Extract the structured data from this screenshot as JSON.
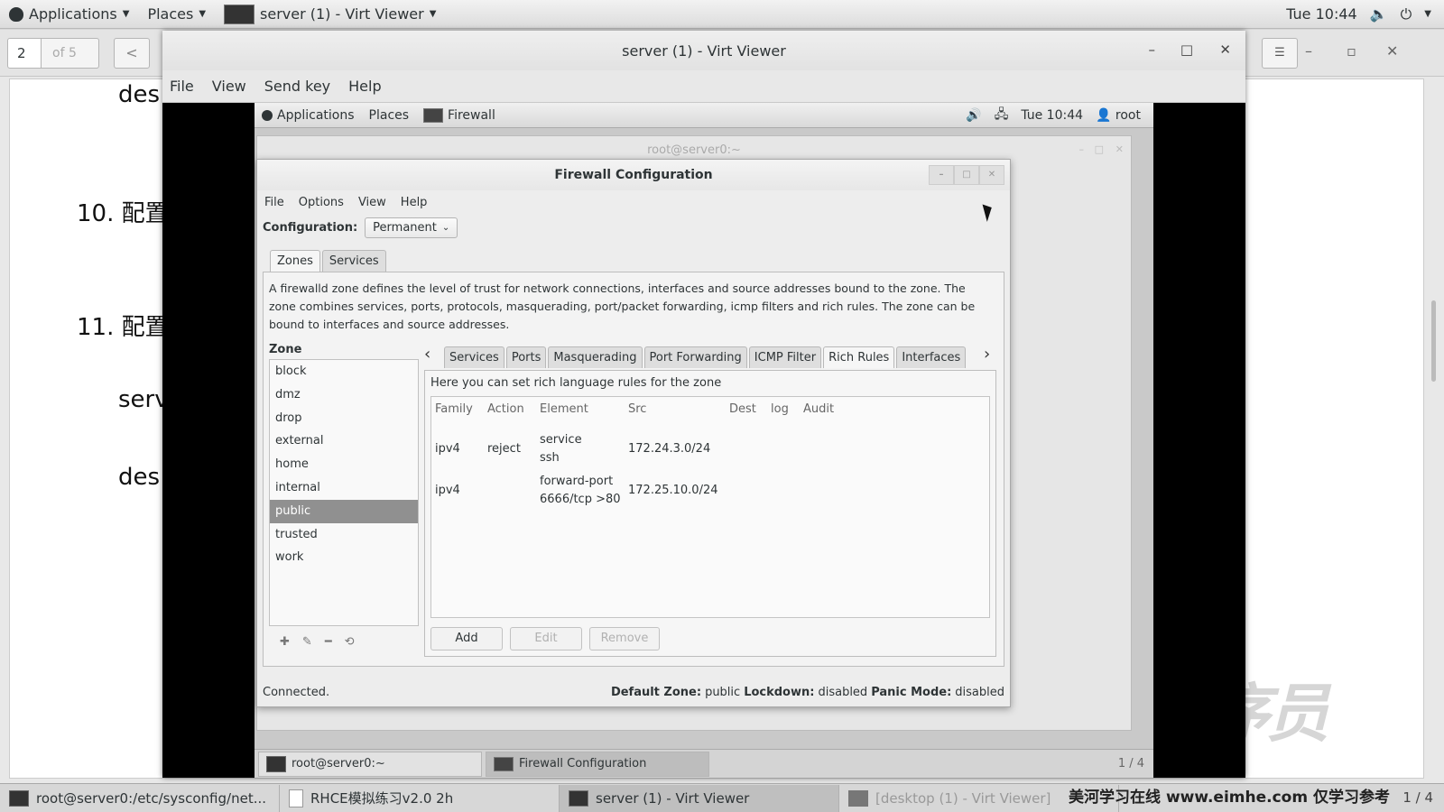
{
  "host": {
    "topbar": {
      "applications": "Applications",
      "places": "Places",
      "active_app": "server (1) - Virt Viewer",
      "clock": "Tue 10:44"
    },
    "doc_viewer": {
      "page_current": "2",
      "page_total": "of 5",
      "lines": [
        "des",
        "10. 配置",
        "11. 配置",
        "serv",
        "des"
      ]
    },
    "taskbar": {
      "items": [
        {
          "label": "root@server0:/etc/sysconfig/net..."
        },
        {
          "label": "RHCE模拟练习v2.0 2h"
        },
        {
          "label": "server (1) - Virt Viewer"
        },
        {
          "label": "[desktop (1) - Virt Viewer]"
        }
      ],
      "watermark_text": "美河学习在线 www.eimhe.com 仅学习参考",
      "pager": "1 / 4"
    }
  },
  "virt_viewer": {
    "title": "server (1) - Virt Viewer",
    "menu": [
      "File",
      "View",
      "Send key",
      "Help"
    ]
  },
  "guest": {
    "topbar": {
      "applications": "Applications",
      "places": "Places",
      "active_app": "Firewall",
      "clock": "Tue 10:44",
      "user": "root"
    },
    "bg_terminal_title": "root@server0:~",
    "taskbar": {
      "items": [
        {
          "label": "root@server0:~"
        },
        {
          "label": "Firewall Configuration"
        }
      ],
      "pager": "1 / 4"
    }
  },
  "firewall": {
    "title": "Firewall Configuration",
    "menu": [
      "File",
      "Options",
      "View",
      "Help"
    ],
    "config_label": "Configuration:",
    "config_value": "Permanent",
    "main_tabs": [
      "Zones",
      "Services"
    ],
    "description": "A firewalld zone defines the level of trust for network connections, interfaces and source addresses bound to the zone. The zone combines services, ports, protocols, masquerading, port/packet forwarding, icmp filters and rich rules. The zone can be bound to interfaces and source addresses.",
    "zone_header": "Zone",
    "zones": [
      "block",
      "dmz",
      "drop",
      "external",
      "home",
      "internal",
      "public",
      "trusted",
      "work"
    ],
    "selected_zone": "public",
    "sub_tabs": [
      "Services",
      "Ports",
      "Masquerading",
      "Port Forwarding",
      "ICMP Filter",
      "Rich Rules",
      "Interfaces"
    ],
    "active_sub_tab": "Rich Rules",
    "rich_hint": "Here you can set rich language rules for the zone",
    "columns": [
      "Family",
      "Action",
      "Element",
      "Src",
      "Dest",
      "log",
      "Audit"
    ],
    "rules": [
      {
        "family": "ipv4",
        "action": "reject",
        "element_1": "service",
        "element_2": "ssh",
        "src": "172.24.3.0/24"
      },
      {
        "family": "ipv4",
        "action": "",
        "element_1": "forward-port",
        "element_2": "6666/tcp >80",
        "src": "172.25.10.0/24"
      }
    ],
    "buttons": [
      "Add",
      "Edit",
      "Remove"
    ],
    "status_left": "Connected.",
    "status_default_zone_label": "Default Zone:",
    "status_default_zone": "public",
    "status_lockdown_label": "Lockdown:",
    "status_lockdown": "disabled",
    "status_panic_label": "Panic Mode:",
    "status_panic": "disabled"
  }
}
